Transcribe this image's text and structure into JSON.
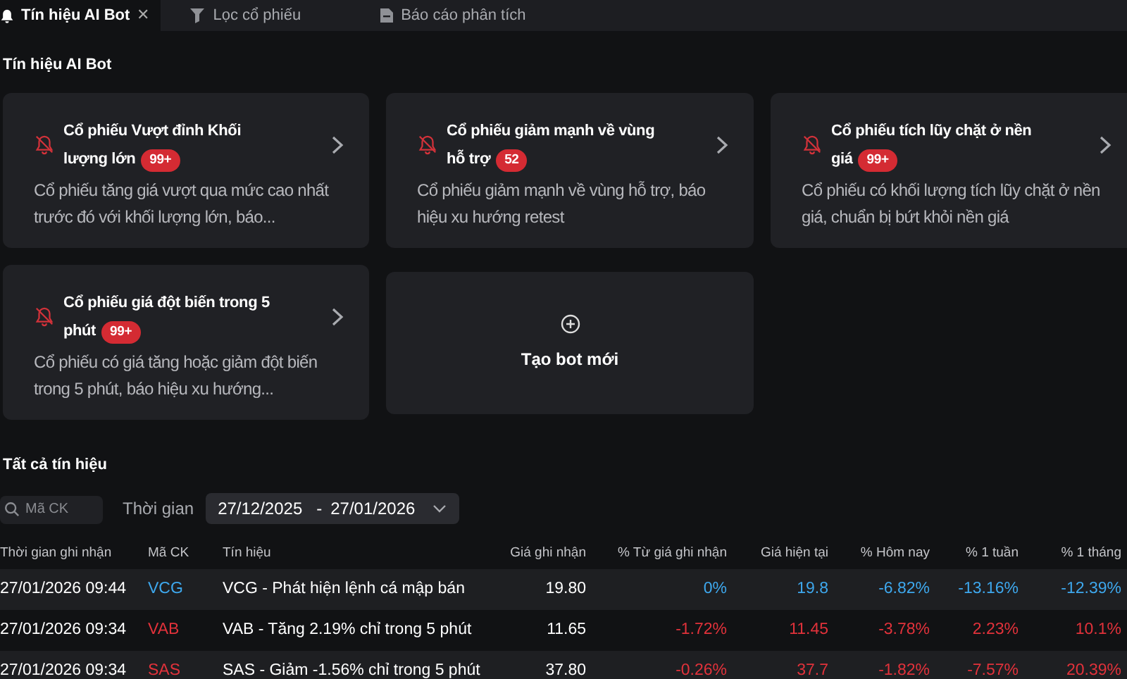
{
  "tabs": [
    {
      "label": "Tín hiệu AI Bot",
      "selected": true,
      "close": "✕"
    },
    {
      "label": "Lọc cổ phiếu",
      "selected": false
    },
    {
      "label": "Báo cáo phân tích",
      "selected": false
    }
  ],
  "section_title": "Tín hiệu AI Bot",
  "bots": [
    {
      "title": "Cổ phiếu Vượt đỉnh Khối lượng lớn",
      "badge": "99+",
      "description": "Cổ phiếu tăng giá vượt qua mức cao nhất trước đó với khối lượng lớn, báo..."
    },
    {
      "title": "Cổ phiếu giảm mạnh về vùng hỗ trợ",
      "badge": "52",
      "description": "Cổ phiếu giảm mạnh về vùng hỗ trợ, báo hiệu xu hướng retest"
    },
    {
      "title": "Cổ phiếu tích lũy chặt ở nền giá",
      "badge": "99+",
      "description": "Cổ phiếu có khối lượng tích lũy chặt ở nền giá, chuẩn bị bứt khỏi nền giá"
    },
    {
      "title": "Cổ phiếu giá đột biến trong 5 phút",
      "badge": "99+",
      "description": "Cổ phiếu có giá tăng hoặc giảm đột biến trong 5 phút, báo hiệu xu hướng..."
    }
  ],
  "new_bot": {
    "label": "Tạo bot mới"
  },
  "signals_title": "Tất cả tín hiệu",
  "filters": {
    "search": {
      "placeholder": "Mã CK"
    },
    "time_label": "Thời gian",
    "date_from": "27/12/2025",
    "date_separator": "-",
    "date_to": "27/01/2026"
  },
  "table": {
    "columns": [
      "Thời gian ghi nhận",
      "Mã CK",
      "Tín hiệu",
      "Giá ghi nhận",
      "% Từ giá ghi nhận",
      "Giá hiện tại",
      "% Hôm nay",
      "% 1 tuần",
      "% 1 tháng"
    ],
    "rows": [
      {
        "color": "#3ea8ee",
        "cells": [
          "27/01/2026 09:44",
          "VCG",
          "VCG - Phát hiện lệnh cá mập bán",
          "19.80",
          "0%",
          "19.8",
          "-6.82%",
          "-13.16%",
          "-12.39%"
        ]
      },
      {
        "color": "#e2323b",
        "cells": [
          "27/01/2026 09:34",
          "VAB",
          "VAB - Tăng 2.19% chỉ trong 5 phút",
          "11.65",
          "-1.72%",
          "11.45",
          "-3.78%",
          "2.23%",
          "10.1%"
        ]
      },
      {
        "color": "#e2323b",
        "cells": [
          "27/01/2026 09:34",
          "SAS",
          "SAS - Giảm -1.56% chỉ trong 5 phút",
          "37.80",
          "-0.26%",
          "37.7",
          "-1.82%",
          "-7.57%",
          "20.39%"
        ]
      }
    ]
  }
}
